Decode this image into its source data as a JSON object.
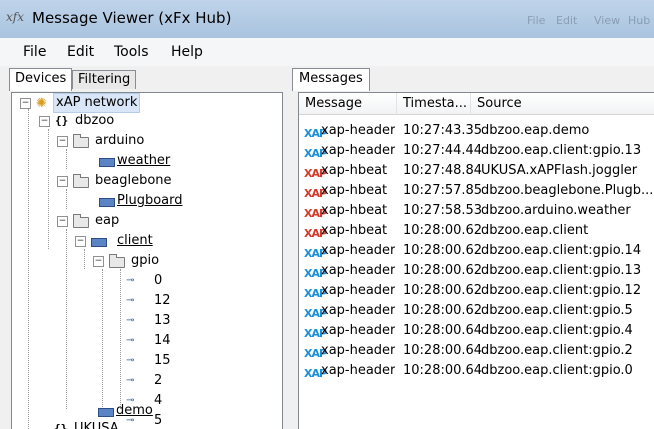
{
  "window": {
    "icon_text": "xfx",
    "title": "Message Viewer (xFx Hub)"
  },
  "background_window": {
    "menu": [
      "File",
      "Edit",
      "View"
    ],
    "title_part": "Hub"
  },
  "menu": {
    "items": [
      "File",
      "Edit",
      "Tools",
      "Help"
    ]
  },
  "left_tabs": [
    "Devices",
    "Filtering"
  ],
  "right_tabs": [
    "Messages"
  ],
  "tree": {
    "root": "xAP network",
    "dbzoo": "dbzoo",
    "arduino": "arduino",
    "weather": "weather",
    "beaglebone": "beaglebone",
    "plugboard": "Plugboard",
    "eap": "eap",
    "client": "client",
    "gpio": "gpio",
    "pins": [
      "0",
      "12",
      "13",
      "14",
      "15",
      "2",
      "4",
      "5"
    ],
    "demo": "demo",
    "ukusa": "UKUSA"
  },
  "messages": {
    "columns": [
      "Message",
      "Timesta...",
      "Source"
    ],
    "rows": [
      {
        "type": "xap-header",
        "time": "10:27:43.35",
        "source": "dbzoo.eap.demo"
      },
      {
        "type": "xap-header",
        "time": "10:27:44.44",
        "source": "dbzoo.eap.client:gpio.13"
      },
      {
        "type": "xap-hbeat",
        "time": "10:27:48.84",
        "source": "UKUSA.xAPFlash.joggler"
      },
      {
        "type": "xap-hbeat",
        "time": "10:27:57.85",
        "source": "dbzoo.beaglebone.Plugb..."
      },
      {
        "type": "xap-hbeat",
        "time": "10:27:58.53",
        "source": "dbzoo.arduino.weather"
      },
      {
        "type": "xap-hbeat",
        "time": "10:28:00.62",
        "source": "dbzoo.eap.client"
      },
      {
        "type": "xap-header",
        "time": "10:28:00.62",
        "source": "dbzoo.eap.client:gpio.14"
      },
      {
        "type": "xap-header",
        "time": "10:28:00.62",
        "source": "dbzoo.eap.client:gpio.13"
      },
      {
        "type": "xap-header",
        "time": "10:28:00.62",
        "source": "dbzoo.eap.client:gpio.12"
      },
      {
        "type": "xap-header",
        "time": "10:28:00.62",
        "source": "dbzoo.eap.client:gpio.5"
      },
      {
        "type": "xap-header",
        "time": "10:28:00.64",
        "source": "dbzoo.eap.client:gpio.4"
      },
      {
        "type": "xap-header",
        "time": "10:28:00.64",
        "source": "dbzoo.eap.client:gpio.2"
      },
      {
        "type": "xap-header",
        "time": "10:28:00.64",
        "source": "dbzoo.eap.client:gpio.0"
      }
    ]
  },
  "icons": {
    "xap_badge": "XAP",
    "header_color": "#1a8fd6",
    "hbeat_color": "#d23a2a"
  }
}
